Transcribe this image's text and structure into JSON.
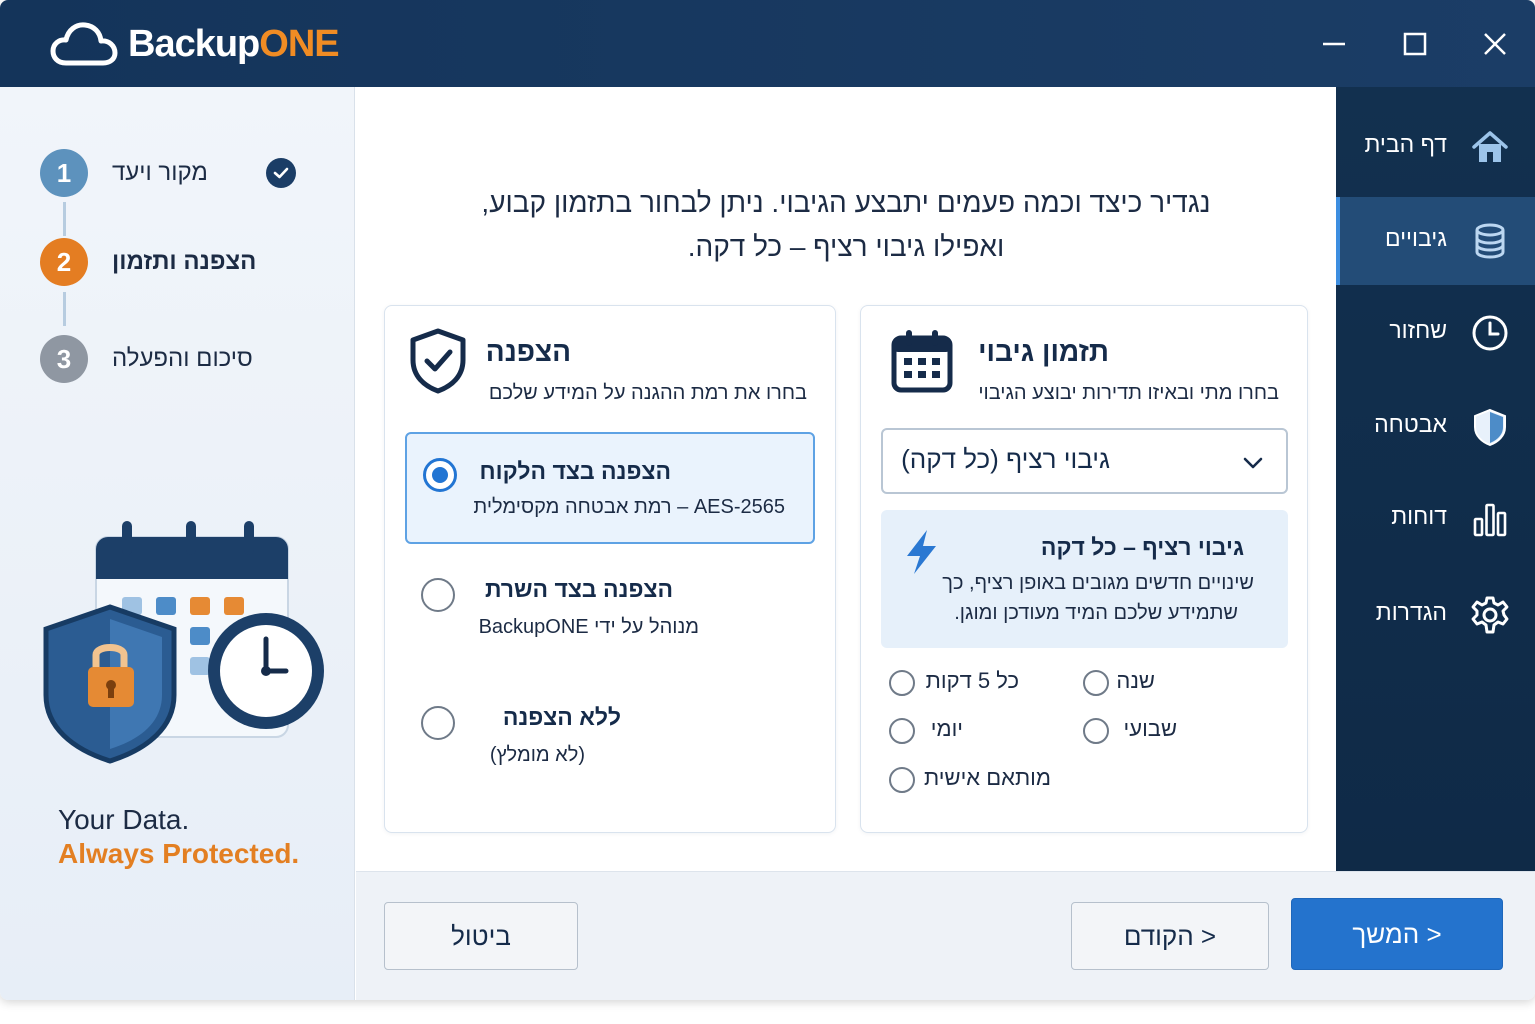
{
  "app": {
    "brand_main": "Backup",
    "brand_accent": "ONE"
  },
  "colors": {
    "navy": "#14345a",
    "accent_orange": "#f08c24",
    "primary_blue": "#2473cd"
  },
  "window_controls": [
    "minimize-icon",
    "maximize-icon",
    "close-icon"
  ],
  "wizard": {
    "steps": [
      {
        "num": "1",
        "label": "מקור ויעד",
        "status": "done"
      },
      {
        "num": "2",
        "label": "הצפנה ותזמון",
        "status": "current"
      },
      {
        "num": "3",
        "label": "סיכום והפעלה",
        "status": "pending"
      }
    ],
    "tagline_line1": "Your Data.",
    "tagline_line2": "Always Protected."
  },
  "intro": {
    "line1": "נגדיר כיצד וכמה פעמים יתבצע הגיבוי. ניתן לבחור בתזמון קבוע,",
    "line2": "ואפילו גיבוי רציף – כל דקה."
  },
  "encryption": {
    "title": "הצפנה",
    "subtitle": "בחרו את רמת ההגנה על המידע שלכם",
    "options": [
      {
        "title": "הצפנה בצד הלקוח",
        "sub": "AES-2565 – רמת אבטחה מקסימלית",
        "selected": true
      },
      {
        "title": "הצפנה בצד השרת",
        "sub": "מנוהל על ידי BackupONE",
        "selected": false
      },
      {
        "title": "ללא הצפנה",
        "sub": "(לא מומלץ)",
        "selected": false
      }
    ]
  },
  "schedule": {
    "title": "תזמון גיבוי",
    "subtitle": "בחרו מתי ובאיזו תדירות יבוצע הגיבוי",
    "dropdown_value": "גיבוי רציף (כל דקה)",
    "info_title": "גיבוי רציף – כל דקה",
    "info_line1": "שינויים חדשים מגובים באופן רציף, כך",
    "info_line2": "שתמידע שלכם המיד מעודכן ומוגן.",
    "options": [
      {
        "label": "כל 5 דקות"
      },
      {
        "label": "שנה"
      },
      {
        "label": "יומי"
      },
      {
        "label": "שבועי"
      },
      {
        "label": "מותאם אישית"
      }
    ]
  },
  "nav": {
    "items": [
      {
        "label": "דף הבית",
        "icon": "home-icon",
        "active": false
      },
      {
        "label": "גיבויים",
        "icon": "database-icon",
        "active": true
      },
      {
        "label": "שחזור",
        "icon": "clock-icon",
        "active": false
      },
      {
        "label": "אבטחה",
        "icon": "shield-icon",
        "active": false
      },
      {
        "label": "דוחות",
        "icon": "bar-chart-icon",
        "active": false
      },
      {
        "label": "הגדרות",
        "icon": "gear-icon",
        "active": false
      }
    ]
  },
  "footer": {
    "cancel_label": "ביטול",
    "back_label": "< הקודם",
    "next_label": "< המשך"
  }
}
